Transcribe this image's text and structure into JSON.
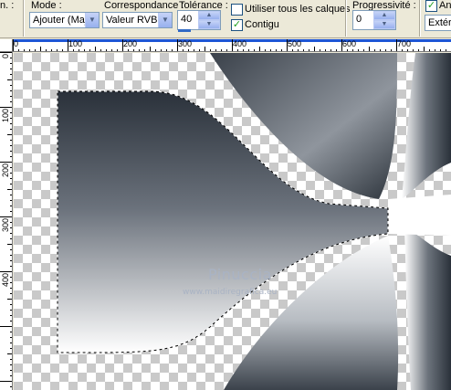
{
  "toolbar": {
    "truncated_left_label": "n. :",
    "mode_label": "Mode :",
    "mode_value": "Ajouter (Maj)",
    "correspondance_label": "Correspondance :",
    "correspondance_value": "Valeur RVB",
    "tolerance_label": "Tolérance :",
    "tolerance_value": "40",
    "use_all_layers_label": "Utiliser tous les calques",
    "use_all_layers_checked": false,
    "contiguous_label": "Contigu",
    "contiguous_checked": true,
    "progressivite_label": "Progressivité :",
    "progressivite_value": "0",
    "antialias_label": "Ant",
    "antialias_value": "Extérie",
    "antialias_checked": true
  },
  "ruler_top": [
    "0",
    "100",
    "200",
    "300",
    "400",
    "500",
    "600",
    "700"
  ],
  "ruler_left": [
    "0",
    "100",
    "200",
    "300",
    "400"
  ],
  "canvas": {
    "watermark_title": "Pinuccia",
    "watermark_url": "www.maidiregrafica.eu",
    "gradient_dark": "#2a313a",
    "gradient_light": "#ffffff"
  }
}
